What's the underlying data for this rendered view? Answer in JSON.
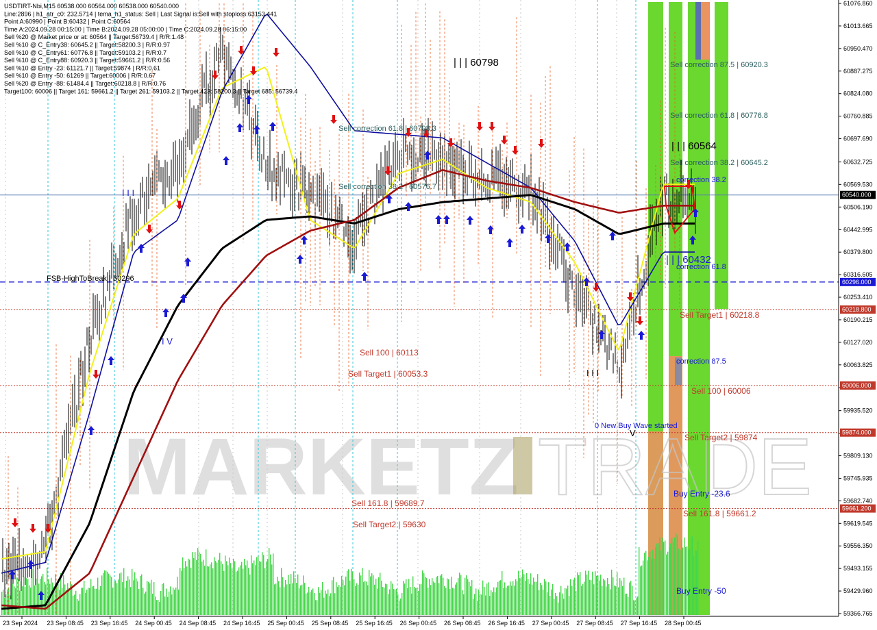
{
  "info": {
    "lines": [
      "USDTIRT-Nbi,M15  60538.000 60564.000 60538.000 60540.000",
      "Line:2896  |  h1_atr_c0: 232.5714  |  tema_h1_status: Sell  |  Last Signal is:Sell with stoploss:63153.441",
      "Point A:60990  |  Point B:60432  |  Point C:60564",
      "Time A:2024.09.28 00:15:00  |  Time B:2024.09.28 05:00:00  |  Time C:2024.09.28 06:15:00",
      "Sell %20 @ Market price or at: 60564  ||  Target:56739.4  |  R/R:1.48",
      "Sell %10 @ C_Entry38: 60645.2  ||  Target:58200.3  |  R/R:0.97",
      "Sell %10 @ C_Entry61: 60776.8  ||  Target:59103.2  |  R/R:0.7",
      "Sell %10 @ C_Entry88: 60920.3  ||  Target:59661.2  |  R/R:0.56",
      "Sell %10 @ Entry -23: 61121.7  ||  Target:59874  |  R/R:0.61",
      "Sell %10 @ Entry -50: 61269  ||  Target:60006  |  R/R:0.67",
      "Sell %20 @ Entry -88: 61484.4  ||  Target:60218.8  |  R/R:0.76",
      "Target100: 60006  ||  Target 161: 59661.2  ||  Target 261: 59103.2  ||  Target 423: 58200.3  ||  Target 685: 56739.4"
    ]
  },
  "price_axis": {
    "ticks": [
      "61076.860",
      "61013.665",
      "60950.470",
      "60887.275",
      "60824.080",
      "60760.885",
      "60697.690",
      "60632.725",
      "60569.530",
      "60506.190",
      "60442.995",
      "60379.800",
      "60316.605",
      "60253.410",
      "60190.215",
      "60127.020",
      "60063.825",
      "59999.760",
      "59935.520",
      "59872.325",
      "59809.130",
      "59745.935",
      "59682.740",
      "59619.545",
      "59556.350",
      "59493.155",
      "59429.960",
      "59366.765"
    ],
    "badges": [
      {
        "value": "60540.000",
        "bg": "#000000",
        "fg": "#ffffff"
      },
      {
        "value": "60296.000",
        "bg": "#1a1ad6",
        "fg": "#ffffff"
      },
      {
        "value": "60218.800",
        "bg": "#c0392b",
        "fg": "#ffffff"
      },
      {
        "value": "60006.000",
        "bg": "#c0392b",
        "fg": "#ffffff"
      },
      {
        "value": "59874.000",
        "bg": "#c0392b",
        "fg": "#ffffff"
      },
      {
        "value": "59661.200",
        "bg": "#c0392b",
        "fg": "#ffffff"
      }
    ]
  },
  "time_axis": {
    "labels": [
      "23 Sep 2024",
      "23 Sep 08:45",
      "23 Sep 16:45",
      "24 Sep 00:45",
      "24 Sep 08:45",
      "24 Sep 16:45",
      "25 Sep 00:45",
      "25 Sep 08:45",
      "25 Sep 16:45",
      "26 Sep 00:45",
      "26 Sep 08:45",
      "26 Sep 16:45",
      "27 Sep 00:45",
      "27 Sep 08:45",
      "27 Sep 16:45",
      "28 Sep 00:45"
    ]
  },
  "watermark": {
    "text_a": "MARKETZ",
    "text_b": "TRADE"
  },
  "levels": {
    "fsb": "FSB-HighToBreak | 60296",
    "sell_target1_right": "Sell Target1 | 60218.8",
    "sell_100_right": "Sell 100 | 60006",
    "sell_target2_right": "Sell Target2 | 59874",
    "sell_161_right": "Sell 161.8 | 59661.2",
    "sell_100_mid": "Sell 100 | 60113",
    "sell_target1_mid": "Sell Target1 | 60053.3",
    "sell_161_mid": "Sell 161.8 | 59689.7",
    "sell_target2_mid": "Sell Target2 | 59630",
    "sell_corr_618_mid": "Sell correction 61.8 | 60708.3",
    "sell_corr_382_mid": "Sell correction 38.2 | 60576.7",
    "sell_corr_875_right": "Sell correction 87.5 | 60920.3",
    "sell_corr_618_right": "Sell correction 61.8 | 60776.8",
    "sell_corr_382_right": "Sell correction 38.2 | 60645.2",
    "correction_382": "correction 38.2",
    "correction_618": "correction 61.8",
    "correction_875": "correction 87.5",
    "new_buy_wave": "0 New Buy Wave started",
    "buy_entry_23": "Buy Entry -23.6",
    "buy_entry_50": "Buy Entry -50",
    "point_60798": "| | | 60798",
    "point_60564": "| | | 60564",
    "point_60432": "| | | 60432",
    "marks_iii_a": "I I I",
    "marks_iii_b": "I I I",
    "marks_iv": "I V",
    "marks_v": "V"
  },
  "chart_data": {
    "type": "line",
    "title": "USDTIRT-Nbi,M15",
    "symbol": "USDTIRT-Nbi",
    "timeframe": "M15",
    "ylim": [
      59366.765,
      61076.86
    ],
    "x": [
      "23 Sep 2024",
      "23 Sep 08:45",
      "23 Sep 16:45",
      "24 Sep 00:45",
      "24 Sep 08:45",
      "24 Sep 16:45",
      "25 Sep 00:45",
      "25 Sep 08:45",
      "25 Sep 16:45",
      "26 Sep 00:45",
      "26 Sep 08:45",
      "26 Sep 16:45",
      "27 Sep 00:45",
      "27 Sep 08:45",
      "27 Sep 16:45",
      "28 Sep 00:45"
    ],
    "series": [
      {
        "name": "price",
        "color": "#000000",
        "values": [
          59470,
          59560,
          60140,
          60500,
          60620,
          60960,
          60620,
          60540,
          60420,
          60660,
          60640,
          60590,
          60560,
          60270,
          60060,
          60540
        ]
      },
      {
        "name": "",
        "color": "#f1f11a",
        "values": [
          59520,
          59540,
          60040,
          60430,
          60530,
          60840,
          60900,
          60470,
          60390,
          60600,
          60640,
          60560,
          60520,
          60350,
          60100,
          60570
        ]
      },
      {
        "name": "",
        "color": "#1010a0",
        "values": [
          59480,
          59510,
          59930,
          60380,
          60470,
          60830,
          61050,
          60900,
          60720,
          60710,
          60700,
          60630,
          60560,
          60410,
          60170,
          60380
        ]
      },
      {
        "name": "",
        "color": "#000000",
        "values": [
          59380,
          59390,
          59620,
          59990,
          60230,
          60390,
          60470,
          60480,
          60460,
          60500,
          60520,
          60530,
          60540,
          60500,
          60430,
          60460
        ]
      },
      {
        "name": "",
        "color": "#a01010",
        "values": [
          59390,
          59380,
          59480,
          59750,
          60020,
          60230,
          60370,
          60440,
          60470,
          60560,
          60610,
          60580,
          60560,
          60520,
          60490,
          60510
        ]
      }
    ]
  }
}
